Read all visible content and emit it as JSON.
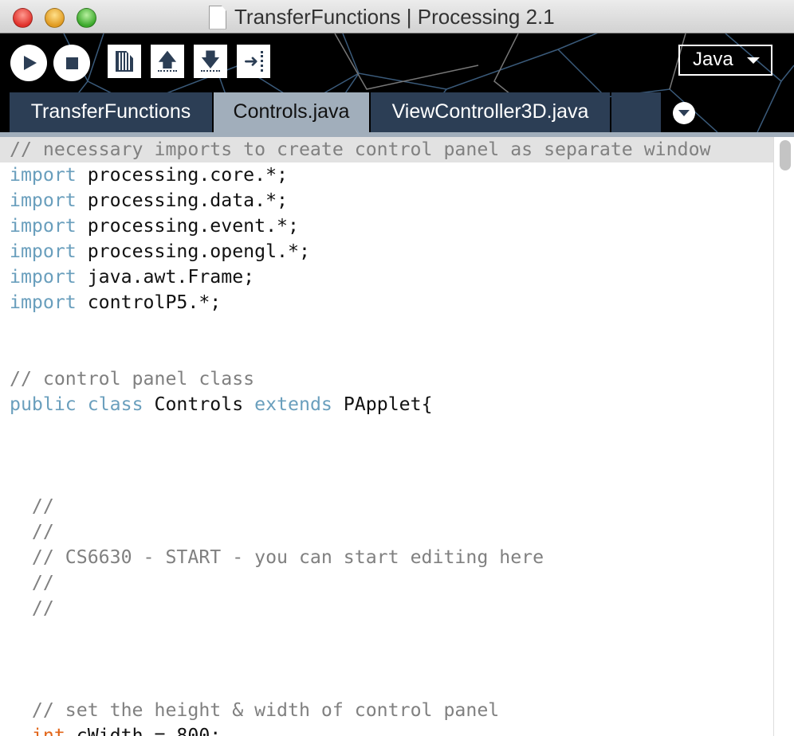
{
  "window": {
    "title": "TransferFunctions | Processing 2.1"
  },
  "toolbar": {
    "buttons": [
      "run",
      "stop",
      "new",
      "open",
      "save",
      "export"
    ],
    "mode": "Java"
  },
  "tabs": [
    {
      "label": "TransferFunctions",
      "active": false
    },
    {
      "label": "Controls.java",
      "active": true
    },
    {
      "label": "ViewController3D.java",
      "active": false
    },
    {
      "label": "",
      "active": false
    }
  ],
  "colors": {
    "tab_bg": "#2c3e55",
    "tab_active": "#a1aebb",
    "keyword": "#6a9fbd",
    "type": "#e2661a",
    "comment": "#808080"
  },
  "code": [
    [
      [
        "comment",
        "// necessary imports to create control panel as separate window"
      ]
    ],
    [
      [
        "kw",
        "import"
      ],
      [
        "plain",
        " processing.core.*;"
      ]
    ],
    [
      [
        "kw",
        "import"
      ],
      [
        "plain",
        " processing.data.*;"
      ]
    ],
    [
      [
        "kw",
        "import"
      ],
      [
        "plain",
        " processing.event.*;"
      ]
    ],
    [
      [
        "kw",
        "import"
      ],
      [
        "plain",
        " processing.opengl.*;"
      ]
    ],
    [
      [
        "kw",
        "import"
      ],
      [
        "plain",
        " java.awt.Frame;"
      ]
    ],
    [
      [
        "kw",
        "import"
      ],
      [
        "plain",
        " controlP5.*;"
      ]
    ],
    [],
    [],
    [
      [
        "comment",
        "// control panel class"
      ]
    ],
    [
      [
        "kw",
        "public"
      ],
      [
        "plain",
        " "
      ],
      [
        "kw",
        "class"
      ],
      [
        "plain",
        " Controls "
      ],
      [
        "kw",
        "extends"
      ],
      [
        "plain",
        " PApplet{"
      ]
    ],
    [],
    [],
    [],
    [
      [
        "plain",
        "  "
      ],
      [
        "comment",
        "//"
      ]
    ],
    [
      [
        "plain",
        "  "
      ],
      [
        "comment",
        "//"
      ]
    ],
    [
      [
        "plain",
        "  "
      ],
      [
        "comment",
        "// CS6630 - START - you can start editing here"
      ]
    ],
    [
      [
        "plain",
        "  "
      ],
      [
        "comment",
        "//"
      ]
    ],
    [
      [
        "plain",
        "  "
      ],
      [
        "comment",
        "//"
      ]
    ],
    [],
    [],
    [],
    [
      [
        "plain",
        "  "
      ],
      [
        "comment",
        "// set the height & width of control panel"
      ]
    ],
    [
      [
        "plain",
        "  "
      ],
      [
        "type",
        "int"
      ],
      [
        "plain",
        " cWidth = 800;"
      ]
    ]
  ]
}
